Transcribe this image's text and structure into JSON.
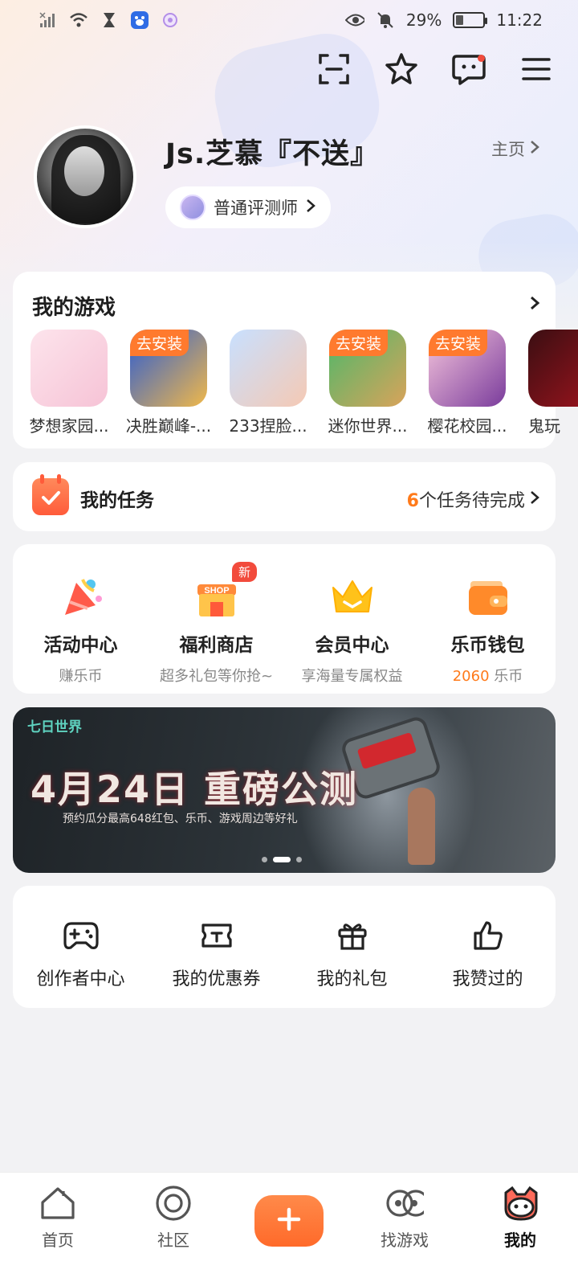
{
  "status_bar": {
    "battery": "29%",
    "time": "11:22",
    "battery_level": 0.29
  },
  "top_actions": [
    "scan-icon",
    "star-icon",
    "message-icon",
    "menu-icon"
  ],
  "profile": {
    "username": "Js.芝慕『不送』",
    "home_link": "主页",
    "badge": "普通评测师"
  },
  "my_games": {
    "title": "我的游戏",
    "items": [
      {
        "name": "梦想家园...",
        "tag": "",
        "colors": [
          "#fde4ec",
          "#f6c3d6"
        ]
      },
      {
        "name": "决胜巅峰-...",
        "tag": "去安装",
        "colors": [
          "#2a5bd4",
          "#f0b84a"
        ]
      },
      {
        "name": "233捏脸...",
        "tag": "",
        "colors": [
          "#c8e0ff",
          "#f5c9b4"
        ]
      },
      {
        "name": "迷你世界...",
        "tag": "去安装",
        "colors": [
          "#4cb86a",
          "#d9a35a"
        ]
      },
      {
        "name": "樱花校园...",
        "tag": "去安装",
        "colors": [
          "#f7c7dd",
          "#7a3c9c"
        ]
      },
      {
        "name": "鬼玩",
        "tag": "",
        "colors": [
          "#3a0e12",
          "#a0141e"
        ]
      }
    ]
  },
  "tasks": {
    "label": "我的任务",
    "count": "6",
    "suffix": "个任务待完成"
  },
  "features": [
    {
      "title": "活动中心",
      "sub": "赚乐币",
      "icon": "party-icon"
    },
    {
      "title": "福利商店",
      "sub": "超多礼包等你抢~",
      "icon": "shop-icon",
      "badge": "新",
      "icon_text": "SHOP"
    },
    {
      "title": "会员中心",
      "sub": "享海量专属权益",
      "icon": "crown-icon"
    },
    {
      "title": "乐币钱包",
      "sub_num": "2060",
      "sub_unit": " 乐币",
      "icon": "wallet-icon"
    }
  ],
  "banner": {
    "logo": "七日世界",
    "headline": "4月24日 重磅公测",
    "subline": "预约瓜分最高648红包、乐币、游戏周边等好礼",
    "slides": 3,
    "active_slide": 2
  },
  "tools": [
    {
      "label": "创作者中心",
      "icon": "gamepad-icon"
    },
    {
      "label": "我的优惠券",
      "icon": "ticket-icon"
    },
    {
      "label": "我的礼包",
      "icon": "gift-icon"
    },
    {
      "label": "我赞过的",
      "icon": "thumbs-up-icon"
    }
  ],
  "bottom_nav": [
    {
      "label": "首页",
      "icon": "home-icon"
    },
    {
      "label": "社区",
      "icon": "community-icon"
    },
    {
      "label": "",
      "icon": "plus-icon"
    },
    {
      "label": "找游戏",
      "icon": "find-games-icon"
    },
    {
      "label": "我的",
      "icon": "profile-cat-icon",
      "active": true
    }
  ],
  "colors": {
    "accent": "#ff7a2e",
    "badge_red": "#f24b3c"
  }
}
